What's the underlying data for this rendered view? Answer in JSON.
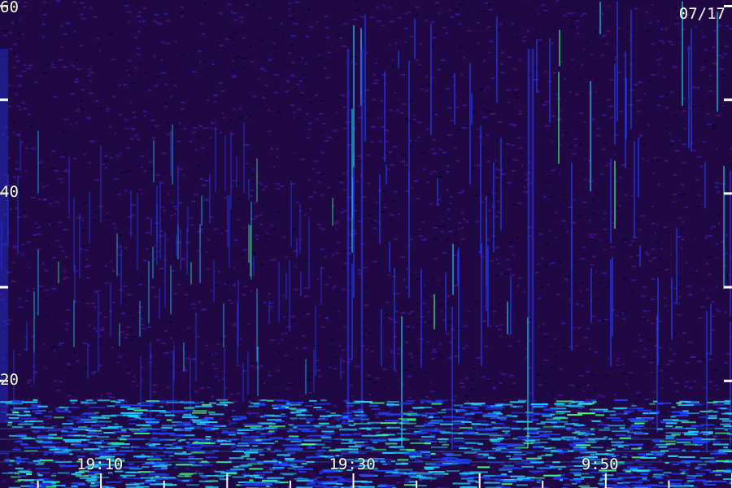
{
  "chart_data": {
    "type": "heatmap",
    "date_label": "07/17",
    "y_ticks": [
      {
        "value": 60,
        "label": "60"
      },
      {
        "value": 50,
        "label": ""
      },
      {
        "value": 40,
        "label": "40"
      },
      {
        "value": 30,
        "label": ""
      },
      {
        "value": 20,
        "label": "20"
      }
    ],
    "x_ticks": [
      {
        "time": "19:10",
        "label": "19:10"
      },
      {
        "time": "19:30",
        "label": "19:30"
      },
      {
        "time": "19:50",
        "label": "9:50"
      }
    ],
    "x_range": [
      "19:02",
      "20:00"
    ],
    "y_range": [
      10,
      60
    ],
    "colors": {
      "background": "#2a0a55",
      "low": "#3a0f7a",
      "mid": "#2040ff",
      "high": "#20d0ff",
      "peak": "#40ff80",
      "hot": "#ff4020",
      "axis": "#ffffff"
    }
  }
}
